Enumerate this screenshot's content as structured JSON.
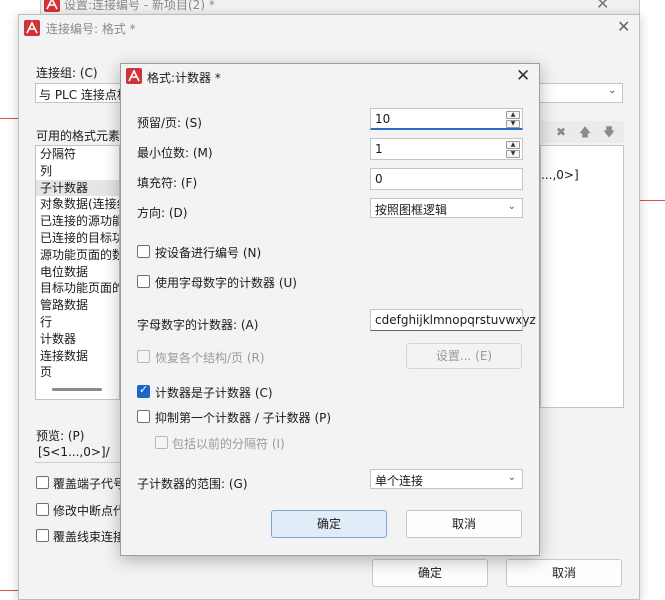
{
  "outer_window": {
    "title": "设置:连接编号 - 新项目(2) *",
    "close_glyph": "✕"
  },
  "format_dialog": {
    "title": "连接编号: 格式 *",
    "close_glyph": "✕",
    "connection_group_label": "连接组: (C)",
    "connection_group_value": "与 PLC 连接点相",
    "available_elements_label": "可用的格式元素:",
    "elements": [
      "分隔符",
      "列",
      "子计数器",
      "对象数据(连接组",
      "已连接的源功能",
      "已连接的目标功",
      "源功能页面的数",
      "电位数据",
      "目标功能页面的",
      "管路数据",
      "行",
      "计数器",
      "连接数据",
      "页"
    ],
    "selected_element_index": 2,
    "format_preview_text": "...,0>]",
    "preview_label": "预览: (P)",
    "preview_value": "[S<1...,0>]/",
    "bottom_checkboxes": [
      {
        "label": "覆盖端子代号",
        "checked": false
      },
      {
        "label": "修改中断点代",
        "checked": false
      },
      {
        "label": "覆盖线束连接",
        "checked": false
      }
    ],
    "ok_label": "确定",
    "cancel_label": "取消"
  },
  "counter_dialog": {
    "title": "格式:计数器 *",
    "close_glyph": "✕",
    "reserve_per_page_label": "预留/页: (S)",
    "reserve_per_page_value": "10",
    "min_digits_label": "最小位数: (M)",
    "min_digits_value": "1",
    "fill_char_label": "填充符: (F)",
    "fill_char_value": "0",
    "direction_label": "方向: (D)",
    "direction_value": "按照图框逻辑",
    "number_by_device_label": "按设备进行编号 (N)",
    "number_by_device_checked": false,
    "use_alnum_counter_label": "使用字母数字的计数器 (U)",
    "use_alnum_counter_checked": false,
    "alnum_counter_label": "字母数字的计数器: (A)",
    "alnum_counter_value": "cdefghijklmnopqrstuvwxyz",
    "restore_per_structure_label": "恢复各个结构/页 (R)",
    "restore_per_structure_checked": false,
    "settings_button_label": "设置... (E)",
    "is_subcounter_label": "计数器是子计数器 (C)",
    "is_subcounter_checked": true,
    "suppress_first_label": "抑制第一个计数器 / 子计数器 (P)",
    "suppress_first_checked": false,
    "include_previous_sep_label": "包括以前的分隔符 (I)",
    "include_previous_sep_checked": false,
    "subcounter_range_label": "子计数器的范围: (G)",
    "subcounter_range_value": "单个连接",
    "ok_label": "确定",
    "cancel_label": "取消"
  },
  "colors": {
    "accent": "#1a67c4",
    "app_icon_red": "#d13438",
    "red_line": "#d9534f"
  }
}
